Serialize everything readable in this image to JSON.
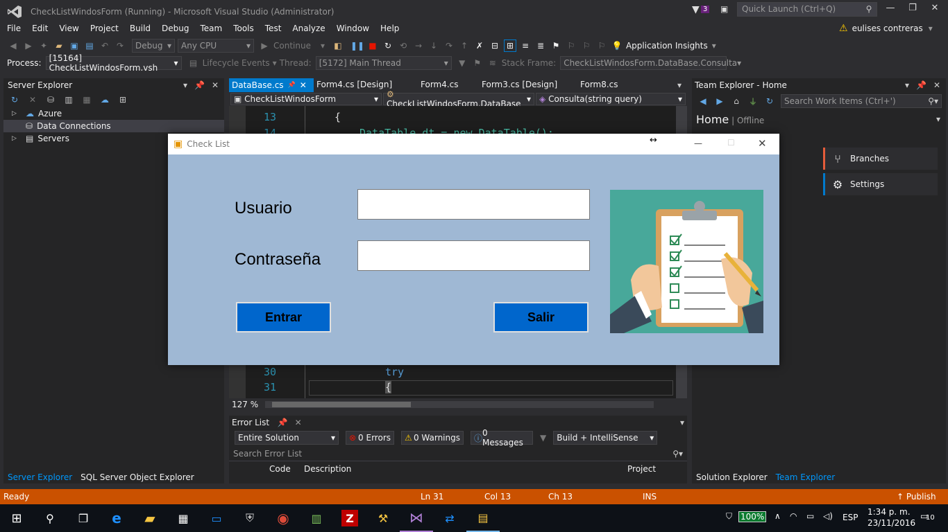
{
  "window": {
    "title": "CheckListWindosForm (Running) - Microsoft Visual Studio (Administrator)",
    "notification_count": "3",
    "quick_launch_placeholder": "Quick Launch (Ctrl+Q)"
  },
  "menu": [
    "File",
    "Edit",
    "View",
    "Project",
    "Build",
    "Debug",
    "Team",
    "Tools",
    "Test",
    "Analyze",
    "Window",
    "Help"
  ],
  "user": {
    "name": "eulises contreras"
  },
  "toolbar": {
    "config": "Debug",
    "platform": "Any CPU",
    "continue_label": "Continue",
    "app_insights": "Application Insights"
  },
  "debug_bar": {
    "process_label": "Process:",
    "process_value": "[15164] CheckListWindosForm.vsh",
    "lifecycle": "Lifecycle Events",
    "thread_label": "Thread:",
    "thread_value": "[5172] Main Thread",
    "stack_label": "Stack Frame:",
    "stack_value": "CheckListWindosForm.DataBase.Consulta"
  },
  "server_explorer": {
    "title": "Server Explorer",
    "items": [
      "Azure",
      "Data Connections",
      "Servers"
    ],
    "tabs": [
      "Server Explorer",
      "SQL Server Object Explorer"
    ]
  },
  "doc_tabs": [
    "DataBase.cs",
    "Form4.cs [Design]",
    "Form4.cs",
    "Form3.cs [Design]",
    "Form8.cs"
  ],
  "nav": {
    "project": "CheckListWindosForm",
    "class": "CheckListWindosForm.DataBase",
    "member": "Consulta(string query)"
  },
  "editor": {
    "lines": [
      {
        "num": "13",
        "code": "{"
      },
      {
        "num": "14",
        "code": "DataTable dt = new DataTable();"
      },
      {
        "num": "30",
        "code": "try"
      },
      {
        "num": "31",
        "code": "{"
      }
    ],
    "zoom": "127 %"
  },
  "error_list": {
    "title": "Error List",
    "scope": "Entire Solution",
    "errors": "0 Errors",
    "warnings": "0 Warnings",
    "messages": "0 Messages",
    "build": "Build + IntelliSense",
    "search_placeholder": "Search Error List",
    "columns": [
      "Code",
      "Description",
      "Project"
    ]
  },
  "team_explorer": {
    "title": "Team Explorer - Home",
    "search_placeholder": "Search Work Items (Ctrl+')",
    "home": "Home",
    "status": "Offline",
    "tiles": [
      "Branches",
      "Settings"
    ],
    "tabs": [
      "Solution Explorer",
      "Team Explorer"
    ]
  },
  "status_bar": {
    "state": "Ready",
    "ln": "Ln 31",
    "col": "Col 13",
    "ch": "Ch 13",
    "ins": "INS",
    "publish": "Publish"
  },
  "taskbar": {
    "battery": "100%",
    "lang": "ESP",
    "time": "1:34 p. m.",
    "date": "23/11/2016",
    "notifications": "10"
  },
  "checklist_form": {
    "title": "Check List",
    "user_label": "Usuario",
    "password_label": "Contraseña",
    "user_value": "",
    "password_value": "",
    "enter_button": "Entrar",
    "exit_button": "Salir"
  },
  "colors": {
    "vs_accent": "#007acc",
    "status_debug": "#ca5100",
    "form_background": "#9fb8d4",
    "form_button": "#0066cc"
  }
}
